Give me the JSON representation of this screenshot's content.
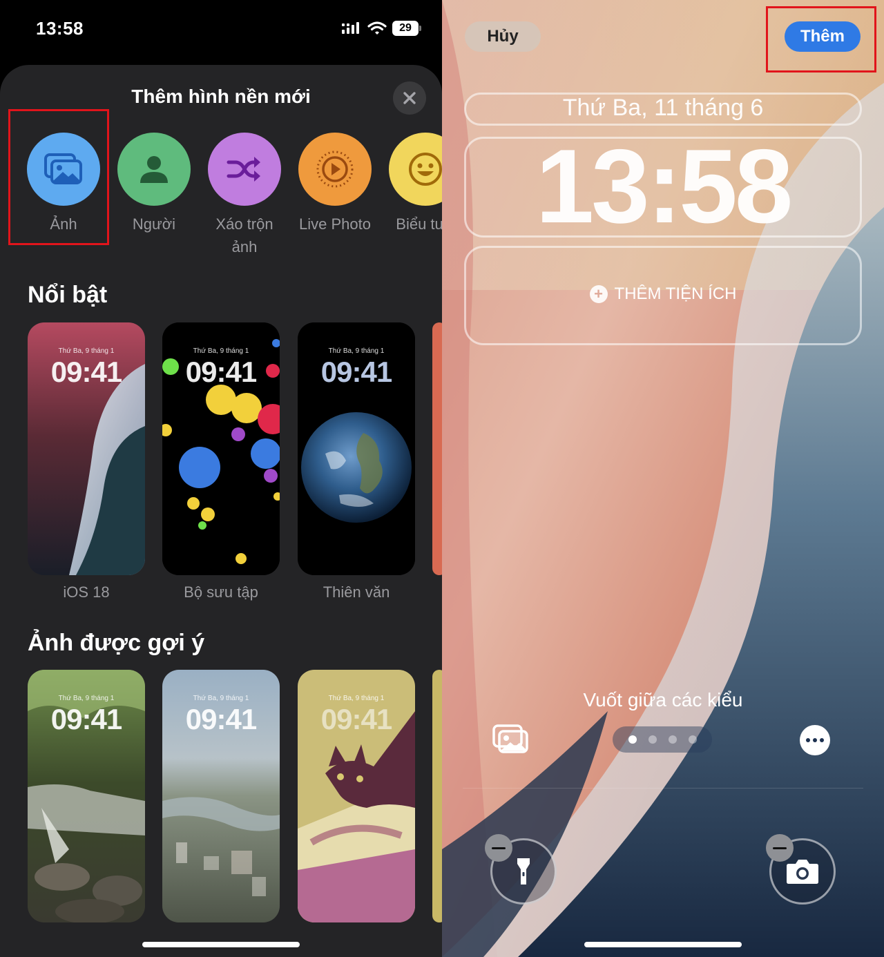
{
  "status_bar": {
    "time": "13:58",
    "battery": "29"
  },
  "sheet": {
    "title": "Thêm hình nền mới",
    "categories": [
      {
        "label": "Ảnh",
        "icon": "photos-icon",
        "color": "#5eaaf0"
      },
      {
        "label": "Người",
        "icon": "person-icon",
        "color": "#5fbb7d"
      },
      {
        "label": "Xáo trộn ảnh",
        "icon": "shuffle-icon",
        "color": "#c07ddf"
      },
      {
        "label": "Live Photo",
        "icon": "live-photo-icon",
        "color": "#ef9a3d"
      },
      {
        "label": "Biểu tượ",
        "icon": "emoji-icon",
        "color": "#f1d65c"
      }
    ],
    "featured": {
      "title": "Nổi bật",
      "items": [
        {
          "label": "iOS 18",
          "date": "Thứ Ba, 9 tháng 1",
          "time": "09:41"
        },
        {
          "label": "Bộ sưu tập",
          "date": "Thứ Ba, 9 tháng 1",
          "time": "09:41"
        },
        {
          "label": "Thiên văn",
          "date": "Thứ Ba, 9 tháng 1",
          "time": "09:41"
        }
      ]
    },
    "suggested": {
      "title": "Ảnh được gợi ý",
      "items": [
        {
          "date": "Thứ Ba, 9 tháng 1",
          "time": "09:41"
        },
        {
          "date": "Thứ Ba, 9 tháng 1",
          "time": "09:41"
        },
        {
          "date": "Thứ Ba, 9 tháng 1",
          "time": "09:41"
        }
      ]
    }
  },
  "lock_preview": {
    "cancel_label": "Hủy",
    "add_label": "Thêm",
    "date": "Thứ Ba, 11 tháng 6",
    "time": "13:58",
    "add_widget_label": "THÊM TIỆN ÍCH",
    "swipe_hint": "Vuốt giữa các kiểu",
    "style_page_count": 4,
    "active_style_page": 1
  },
  "colors": {
    "highlight": "#e1141b",
    "accent_blue": "#2f7ae5",
    "sheet_bg": "#242426"
  }
}
